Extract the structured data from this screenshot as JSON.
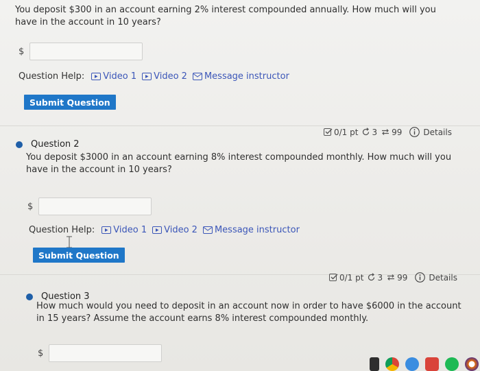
{
  "q1": {
    "text": "You deposit $300 in an account earning 2% interest compounded annually. How much will you have in the account in 10 years?",
    "currency": "$",
    "answer_value": "",
    "help_label": "Question Help:",
    "video1": "Video 1",
    "video2": "Video 2",
    "message": "Message instructor",
    "submit": "Submit Question"
  },
  "q2": {
    "title": "Question 2",
    "score": "0/1 pt",
    "attempts": "3",
    "tries": "99",
    "details": "Details",
    "text": "You deposit $3000 in an account earning 8% interest compounded monthly. How much will you have in the account in 10 years?",
    "currency": "$",
    "answer_value": "",
    "help_label": "Question Help:",
    "video1": "Video 1",
    "video2": "Video 2",
    "message": "Message instructor",
    "submit": "Submit Question"
  },
  "q3": {
    "title": "Question 3",
    "score": "0/1 pt",
    "attempts": "3",
    "tries": "99",
    "details": "Details",
    "text": "How much would you need to deposit in an account now in order to have $6000 in the account in 15 years? Assume the account earns 8% interest compounded monthly.",
    "currency": "$",
    "answer_value": ""
  },
  "colors": {
    "accent": "#1f77c8",
    "link": "#3b56b8",
    "bullet": "#1f5fa8"
  }
}
